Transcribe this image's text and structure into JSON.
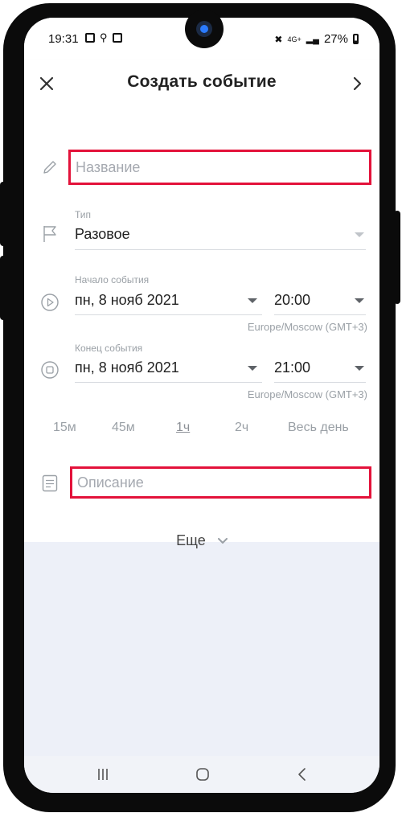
{
  "status_bar": {
    "time": "19:31",
    "network": "4G+",
    "battery": "27%"
  },
  "header": {
    "title": "Создать событие",
    "close_icon": "close-icon",
    "next_icon": "chevron-right-icon"
  },
  "form": {
    "name": {
      "placeholder": "Название",
      "value": ""
    },
    "type": {
      "label": "Тип",
      "value": "Разовое"
    },
    "start": {
      "label": "Начало события",
      "date": "пн, 8 нояб 2021",
      "time": "20:00",
      "timezone": "Europe/Moscow (GMT+3)"
    },
    "end": {
      "label": "Конец события",
      "date": "пн, 8 нояб 2021",
      "time": "21:00",
      "timezone": "Europe/Moscow (GMT+3)"
    },
    "durations": [
      "15м",
      "45м",
      "1ч",
      "2ч",
      "Весь день"
    ],
    "selected_duration": "1ч",
    "description": {
      "placeholder": "Описание",
      "value": ""
    },
    "more_label": "Еще"
  },
  "colors": {
    "highlight_border": "#e3123a",
    "page_bg": "#edf0f8"
  }
}
